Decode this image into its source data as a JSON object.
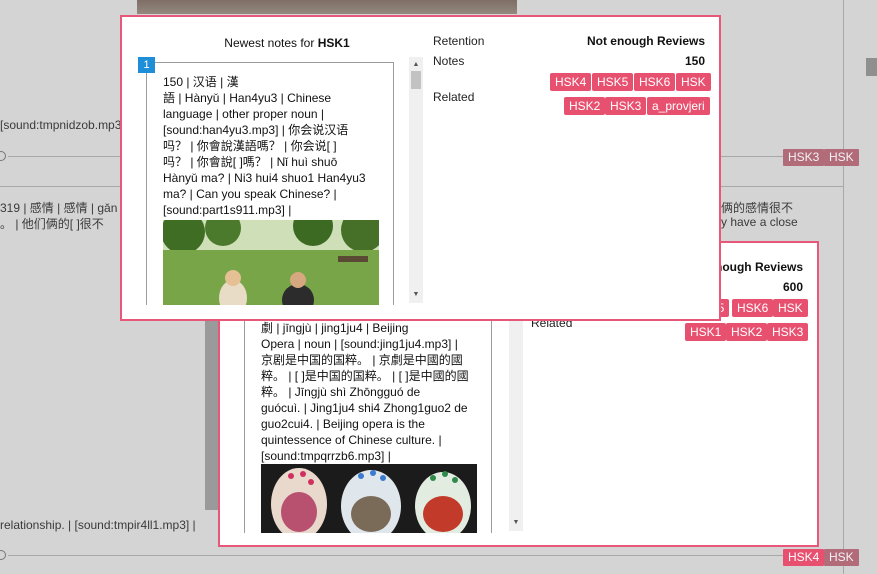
{
  "colors": {
    "accent": "#e8577a",
    "tag": "#e8506f",
    "index_badge": "#1f8ed8"
  },
  "background": {
    "row1_sound": "[sound:tmpnidzob.mp3]",
    "row1_tags": [
      "HSK3",
      "HSK"
    ],
    "row2_left_line1": "319 | 感情 | 感情 | gǎn",
    "row2_left_line2": "。 | 他们俩的[ ]很不",
    "row2_right_line1": "俩的感情很不",
    "row2_right_line2": "y have a close",
    "row2_tail": "relationship. | [sound:tmpir4ll1.mp3] |",
    "row2_tags": [
      "HSK4",
      "HSK"
    ]
  },
  "popup_top": {
    "title_prefix": "Newest notes for",
    "title_deck": "HSK1",
    "index": "1",
    "note_lines": [
      "150 | 汉语 | 漢",
      "語 | Hànyǔ | Han4yu3 | Chinese",
      "language | other proper noun |",
      "[sound:han4yu3.mp3] | 你会说汉语",
      "吗？ | 你會說漢語嗎？ | 你会说[ ]",
      "吗？ | 你會說[ ]嗎？ | Nǐ huì shuō",
      "Hànyǔ ma? | Ni3 hui4 shuo1 Han4yu3",
      "ma? | Can you speak Chinese? |",
      "[sound:part1s911.mp3] |"
    ],
    "retention_label": "Retention",
    "retention_value": "Not enough Reviews",
    "notes_label": "Notes",
    "notes_value": "150",
    "related_label": "Related",
    "related_tags": [
      "HSK4",
      "HSK5",
      "HSK6",
      "HSK",
      "HSK2",
      "HSK3",
      "a_provjeri"
    ]
  },
  "popup_bottom": {
    "retention_value_partial": "nough Reviews",
    "notes_value": "600",
    "related_label": "Related",
    "related_tags": [
      "HSK5",
      "HSK6",
      "HSK",
      "HSK1",
      "HSK2",
      "HSK3"
    ],
    "note_lines": [
      "劇 | jīngjù | jing1ju4 | Beijing",
      "Opera | noun | [sound:jing1ju4.mp3] |",
      "京剧是中国的国粹。 | 京劇是中國的國",
      "粹。 | [ ]是中国的国粹。 | [ ]是中國的國",
      "粹。 | Jīngjù shì Zhōngguó de",
      "guócuì. | Jing1ju4 shi4 Zhong1guo2 de",
      "guo2cui4. | Beijing opera is the",
      "quintessence of Chinese culture. |",
      "[sound:tmpqrrzb6.mp3] |"
    ]
  }
}
